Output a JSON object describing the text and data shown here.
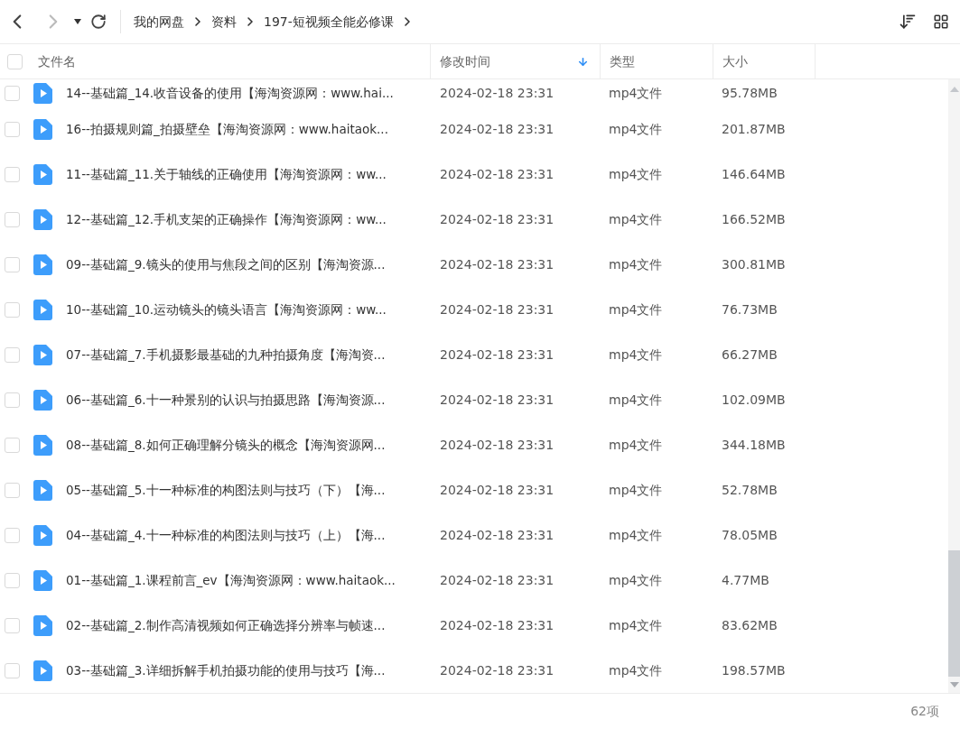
{
  "toolbar": {
    "breadcrumb": [
      {
        "label": "我的网盘"
      },
      {
        "label": "资料"
      },
      {
        "label": "197-短视频全能必修课"
      }
    ]
  },
  "table": {
    "all_checked": false,
    "columns": [
      {
        "label": "文件名",
        "sorted": false
      },
      {
        "label": "修改时间",
        "sorted": true
      },
      {
        "label": "类型",
        "sorted": false
      },
      {
        "label": "大小",
        "sorted": false
      }
    ],
    "rows": [
      {
        "name": "14--基础篇_14.收音设备的使用【海淘资源网：www.hai...",
        "time": "2024-02-18 23:31",
        "type": "mp4文件",
        "size": "95.78MB",
        "checked": false
      },
      {
        "name": "16--拍摄规则篇_拍摄壁垒【海淘资源网：www.haitaok...",
        "time": "2024-02-18 23:31",
        "type": "mp4文件",
        "size": "201.87MB",
        "checked": false
      },
      {
        "name": "11--基础篇_11.关于轴线的正确使用【海淘资源网：ww...",
        "time": "2024-02-18 23:31",
        "type": "mp4文件",
        "size": "146.64MB",
        "checked": false
      },
      {
        "name": "12--基础篇_12.手机支架的正确操作【海淘资源网：ww...",
        "time": "2024-02-18 23:31",
        "type": "mp4文件",
        "size": "166.52MB",
        "checked": false
      },
      {
        "name": "09--基础篇_9.镜头的使用与焦段之间的区别【海淘资源...",
        "time": "2024-02-18 23:31",
        "type": "mp4文件",
        "size": "300.81MB",
        "checked": false
      },
      {
        "name": "10--基础篇_10.运动镜头的镜头语言【海淘资源网：ww...",
        "time": "2024-02-18 23:31",
        "type": "mp4文件",
        "size": "76.73MB",
        "checked": false
      },
      {
        "name": "07--基础篇_7.手机摄影最基础的九种拍摄角度【海淘资...",
        "time": "2024-02-18 23:31",
        "type": "mp4文件",
        "size": "66.27MB",
        "checked": false
      },
      {
        "name": "06--基础篇_6.十一种景别的认识与拍摄思路【海淘资源...",
        "time": "2024-02-18 23:31",
        "type": "mp4文件",
        "size": "102.09MB",
        "checked": false
      },
      {
        "name": "08--基础篇_8.如何正确理解分镜头的概念【海淘资源网...",
        "time": "2024-02-18 23:31",
        "type": "mp4文件",
        "size": "344.18MB",
        "checked": false
      },
      {
        "name": "05--基础篇_5.十一种标准的构图法则与技巧（下）【海...",
        "time": "2024-02-18 23:31",
        "type": "mp4文件",
        "size": "52.78MB",
        "checked": false
      },
      {
        "name": "04--基础篇_4.十一种标准的构图法则与技巧（上）【海...",
        "time": "2024-02-18 23:31",
        "type": "mp4文件",
        "size": "78.05MB",
        "checked": false
      },
      {
        "name": "01--基础篇_1.课程前言_ev【海淘资源网：www.haitaok...",
        "time": "2024-02-18 23:31",
        "type": "mp4文件",
        "size": "4.77MB",
        "checked": false
      },
      {
        "name": "02--基础篇_2.制作高清视频如何正确选择分辨率与帧速...",
        "time": "2024-02-18 23:31",
        "type": "mp4文件",
        "size": "83.62MB",
        "checked": false
      },
      {
        "name": "03--基础篇_3.详细拆解手机拍摄功能的使用与技巧【海...",
        "time": "2024-02-18 23:31",
        "type": "mp4文件",
        "size": "198.57MB",
        "checked": false
      }
    ]
  },
  "footer": {
    "count": "62项"
  }
}
